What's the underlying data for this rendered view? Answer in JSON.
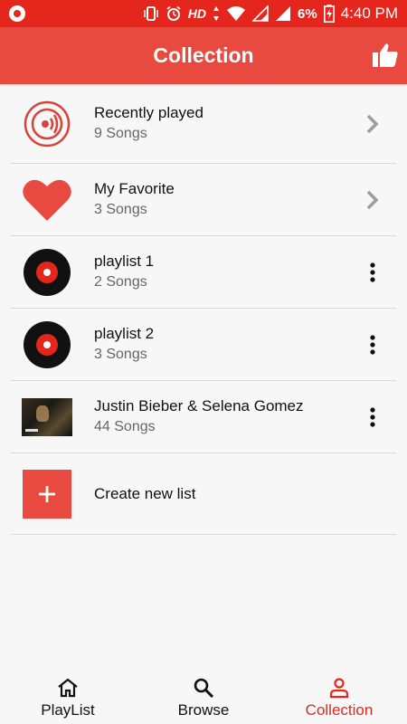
{
  "status_bar": {
    "network": "HD",
    "battery": "6%",
    "time": "4:40 PM",
    "icons": [
      "record-icon",
      "vibrate-icon",
      "alarm-icon",
      "data-arrows-icon",
      "wifi-icon",
      "signal-icon",
      "signal-icon",
      "battery-charging-icon"
    ]
  },
  "header": {
    "title": "Collection",
    "action_icon": "thumbs-up-icon"
  },
  "colors": {
    "status_bar": "#e4261d",
    "header": "#e84a3f",
    "accent": "#e4261d"
  },
  "list": {
    "items": [
      {
        "title": "Recently played",
        "subtitle": "9 Songs",
        "icon": "speaker-icon",
        "action": "chevron-right-icon"
      },
      {
        "title": "My Favorite",
        "subtitle": "3 Songs",
        "icon": "heart-icon",
        "action": "chevron-right-icon"
      },
      {
        "title": "playlist 1",
        "subtitle": "2 Songs",
        "icon": "vinyl-disc-icon",
        "action": "more-vert-icon"
      },
      {
        "title": "playlist 2",
        "subtitle": "3 Songs",
        "icon": "vinyl-disc-icon",
        "action": "more-vert-icon"
      },
      {
        "title": "Justin Bieber & Selena Gomez",
        "subtitle": "44 Songs",
        "icon": "video-thumbnail",
        "action": "more-vert-icon"
      }
    ],
    "create_label": "Create new list"
  },
  "bottom_nav": {
    "items": [
      {
        "label": "PlayList",
        "icon": "home-icon"
      },
      {
        "label": "Browse",
        "icon": "search-icon"
      },
      {
        "label": "Collection",
        "icon": "person-icon",
        "active": true
      }
    ]
  }
}
